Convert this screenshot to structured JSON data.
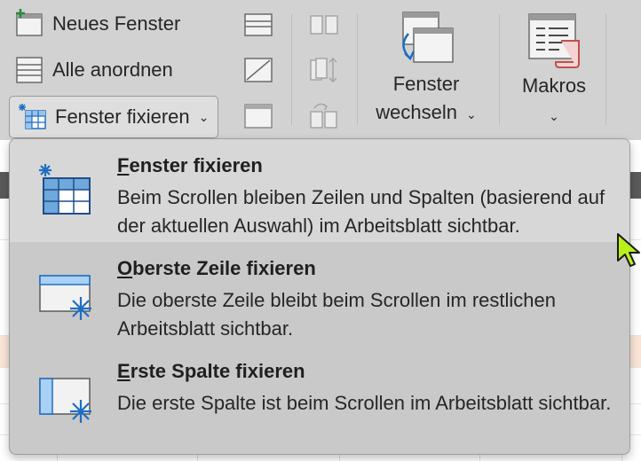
{
  "ribbon": {
    "new_window": "Neues Fenster",
    "arrange_all": "Alle anordnen",
    "freeze_panes": "Fenster fixieren",
    "switch_windows_line1": "Fenster",
    "switch_windows_line2": "wechseln",
    "macros": "Makros"
  },
  "menu": {
    "items": [
      {
        "title_first": "F",
        "title_rest": "enster fixieren",
        "description": "Beim Scrollen bleiben Zeilen und Spalten (basierend auf der aktuellen Auswahl) im Arbeitsblatt sichtbar."
      },
      {
        "title_first": "O",
        "title_rest": "berste Zeile fixieren",
        "description": "Die oberste Zeile bleibt beim Scrollen im restlichen Arbeitsblatt sichtbar."
      },
      {
        "title_first": "E",
        "title_rest": "rste Spalte fixieren",
        "description": "Die erste Spalte ist beim Scrollen im Arbeitsblatt sichtbar."
      }
    ]
  },
  "icons": {
    "new_window": "new-window-icon",
    "arrange_all": "arrange-all-icon",
    "freeze_panes": "freeze-panes-icon",
    "split": "split-icon",
    "hide": "hide-icon",
    "unhide": "unhide-icon",
    "view_side_by_side": "view-side-by-side-icon",
    "synchronous_scrolling": "synchronous-scrolling-icon",
    "reset_window_position": "reset-window-position-icon",
    "switch_windows": "switch-windows-icon",
    "macros": "macros-icon"
  },
  "colors": {
    "accent_blue": "#1e6fc2",
    "cursor_yellow": "#b9f01a",
    "menu_bg": "#c9c9c9",
    "hover_bg": "#d7d7d7"
  }
}
